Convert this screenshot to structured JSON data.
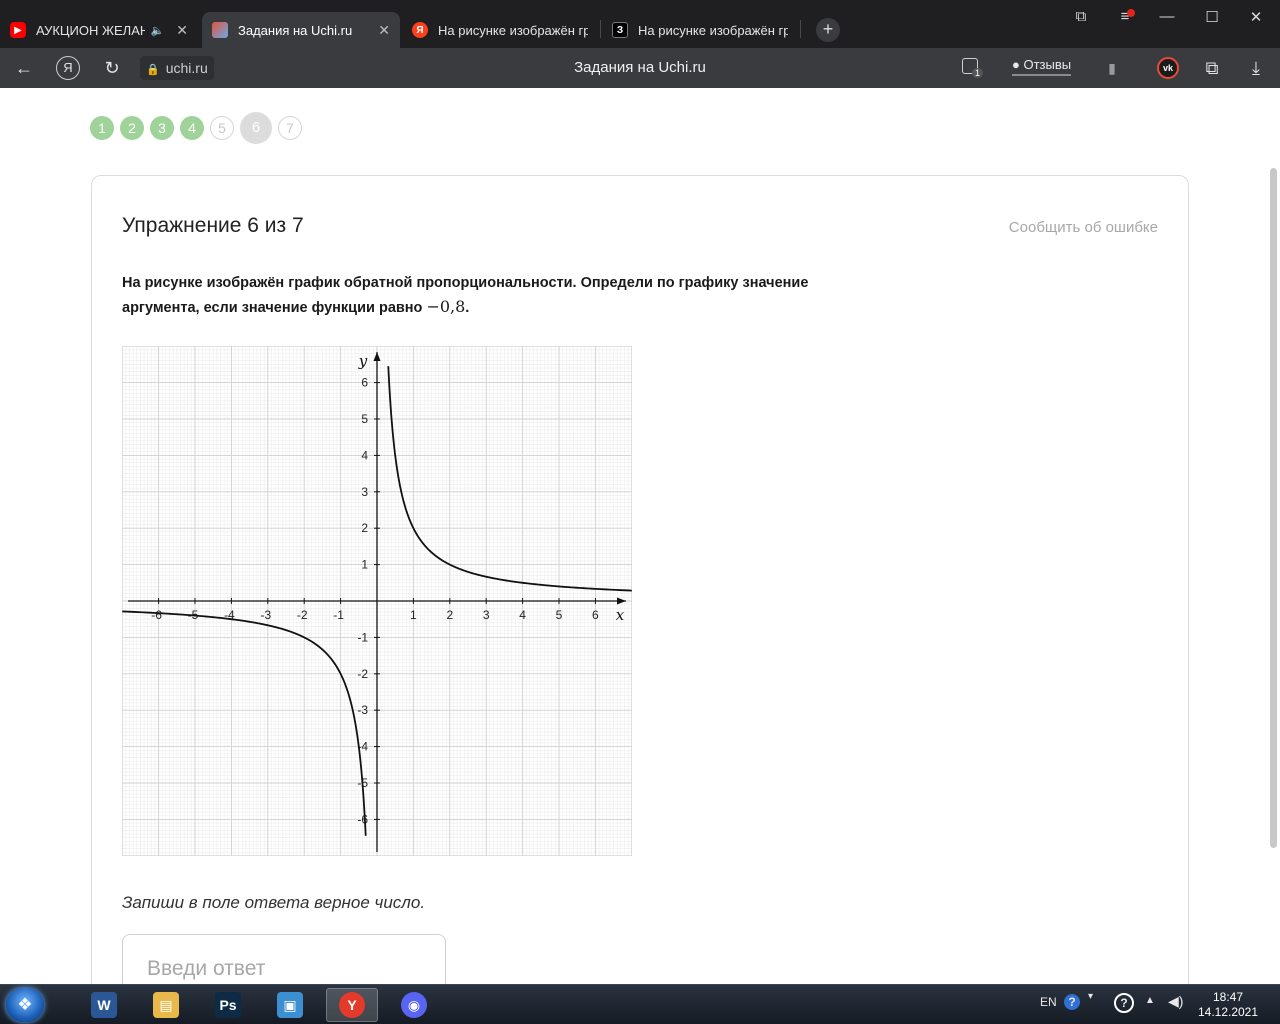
{
  "browser": {
    "tabs": [
      {
        "title": "АУКЦИОН ЖЕЛАНИЙ",
        "favicon_color": "#ff0000",
        "favicon_glyph": "▶",
        "audio_icon": "🔈",
        "close": "✕"
      },
      {
        "title": "Задания на Uchi.ru",
        "favicon_color": "#e5533d",
        "favicon_glyph": "",
        "close": "✕"
      },
      {
        "title": "На рисунке изображён гр",
        "favicon_color": "#fc3f1d",
        "favicon_glyph": "Я"
      },
      {
        "title": "На рисунке изображён гр",
        "favicon_color": "#000000",
        "favicon_glyph": "З"
      }
    ],
    "new_tab": "+",
    "window_controls": {
      "collections": "⧉",
      "menu": "≡",
      "minimize": "—",
      "maximize": "☐",
      "close": "✕"
    },
    "address": {
      "back": "←",
      "yandex": "Я",
      "reload": "↻",
      "lock": "🔒",
      "url": "uchi.ru",
      "page_title": "Задания на Uchi.ru",
      "protect_badge": "1",
      "reviews": "Отзывы",
      "bookmark": "▮",
      "vk": "vk",
      "extensions": "⧉",
      "download": "⤓"
    }
  },
  "steps": [
    {
      "label": "1",
      "state": "done"
    },
    {
      "label": "2",
      "state": "done"
    },
    {
      "label": "3",
      "state": "done"
    },
    {
      "label": "4",
      "state": "done"
    },
    {
      "label": "5",
      "state": "todo"
    },
    {
      "label": "6",
      "state": "current"
    },
    {
      "label": "7",
      "state": "todo"
    }
  ],
  "exercise": {
    "title": "Упражнение 6 из 7",
    "report_link": "Сообщить об ошибке",
    "question_text": "На рисунке изображён график обратной пропорциональности. Определи по графику значение аргумента, если значение функции равно ",
    "question_math": "−0,8",
    "question_end": ".",
    "hint": "Запиши в поле ответа верное число.",
    "answer_placeholder": "Введи ответ"
  },
  "chart_data": {
    "type": "line",
    "function": "y = 2/x",
    "k": 2,
    "x_ticks": [
      -6,
      -5,
      -4,
      -3,
      -2,
      -1,
      1,
      2,
      3,
      4,
      5,
      6
    ],
    "y_ticks": [
      -6,
      -5,
      -4,
      -3,
      -2,
      -1,
      1,
      2,
      3,
      4,
      5,
      6
    ],
    "x_tick_labels": [
      "-6",
      "-5",
      "-4",
      "-3",
      "-2",
      "-1",
      "1",
      "2",
      "3",
      "4",
      "5",
      "6"
    ],
    "y_tick_labels": [
      "-6",
      "-5",
      "-4",
      "-3",
      "-2",
      "-1",
      "1",
      "2",
      "3",
      "4",
      "5",
      "6"
    ],
    "xlabel": "x",
    "ylabel": "y",
    "xlim": [
      -7,
      7
    ],
    "ylim": [
      -7,
      7
    ],
    "grid": true,
    "minor_grid": true,
    "series": [
      {
        "branch": "positive",
        "x": [
          0.31,
          0.5,
          1,
          2,
          3,
          4,
          5,
          6,
          7
        ],
        "y": [
          6.5,
          4,
          2,
          1,
          0.667,
          0.5,
          0.4,
          0.333,
          0.286
        ]
      },
      {
        "branch": "negative",
        "x": [
          -7,
          -6,
          -5,
          -4,
          -3,
          -2,
          -1,
          -0.5,
          -0.31
        ],
        "y": [
          -0.286,
          -0.333,
          -0.4,
          -0.5,
          -0.667,
          -1,
          -2,
          -4,
          -6.5
        ]
      }
    ]
  },
  "taskbar": {
    "apps": [
      {
        "name": "word",
        "glyph": "W",
        "color": "#2b5797"
      },
      {
        "name": "explorer",
        "glyph": "▤",
        "color": "#e8b84a"
      },
      {
        "name": "photoshop",
        "glyph": "Ps",
        "color": "#0e2b45"
      },
      {
        "name": "screen",
        "glyph": "▣",
        "color": "#3c8fd0"
      },
      {
        "name": "yandex-browser",
        "glyph": "Y",
        "color": "#e33a2c"
      },
      {
        "name": "discord",
        "glyph": "◉",
        "color": "#5865f2"
      }
    ],
    "language": "EN",
    "help": "?",
    "time": "18:47",
    "date": "14.12.2021"
  }
}
